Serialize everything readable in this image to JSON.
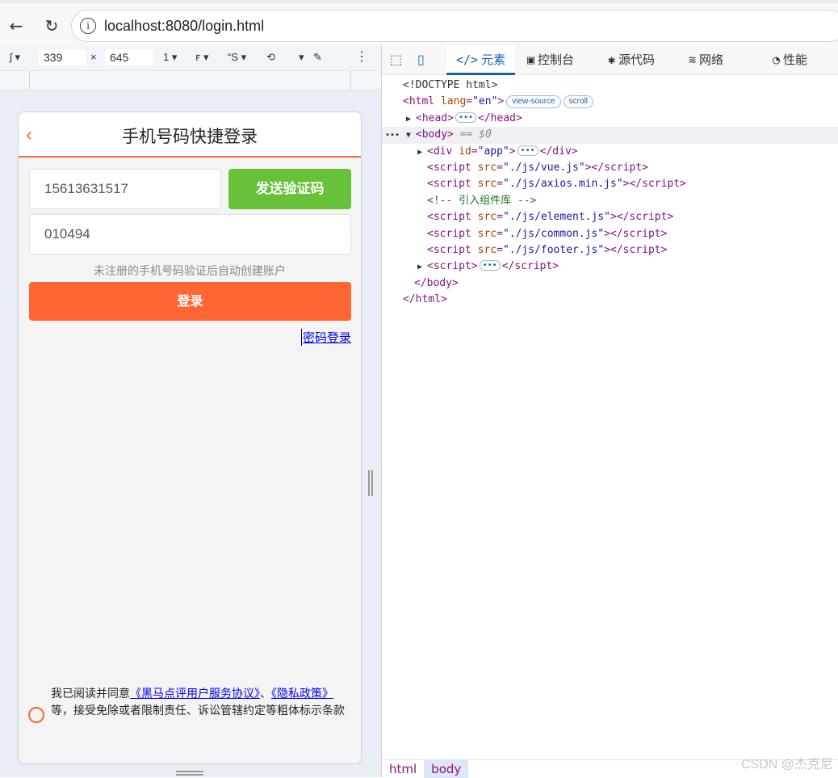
{
  "browser": {
    "url": "localhost:8080/login.html",
    "back_icon": "arrow-left-icon",
    "reload_icon": "reload-icon",
    "info_icon": "info-icon"
  },
  "device_toolbar": {
    "width": "339",
    "height": "645",
    "times": "×",
    "dpr": "1",
    "throttle": "“S",
    "more": "⋮"
  },
  "page": {
    "title": "手机号码快捷登录",
    "phone_value": "15613631517",
    "send_code_label": "发送验证码",
    "code_value": "010494",
    "hint": "未注册的手机号码验证后自动创建账户",
    "login_label": "登录",
    "password_login_link": "密码登录",
    "agreement_prefix": "我已阅读并同意",
    "agreement_link1": "《黑马点评用户服务协议》",
    "agreement_sep": "、",
    "agreement_link2": "《隐私政策》",
    "agreement_suffix": "等，接受免除或者限制责任、诉讼管辖约定等粗体标示条款"
  },
  "devtools": {
    "tabs": [
      {
        "label": "元素",
        "icon": "elements-icon",
        "active": true
      },
      {
        "label": "控制台",
        "icon": "console-icon",
        "active": false
      },
      {
        "label": "源代码",
        "icon": "sources-icon",
        "active": false
      },
      {
        "label": "网络",
        "icon": "network-icon",
        "active": false
      },
      {
        "label": "性能",
        "icon": "performance-icon",
        "active": false
      }
    ],
    "dom": {
      "doctype": "<!DOCTYPE html>",
      "html_lang_value": "\"en\"",
      "view_source_pill": "view-source",
      "scroll_pill": "scroll",
      "body_marker": "== $0",
      "div_id_value": "\"app\"",
      "script_vue": "\"./js/vue.js\"",
      "script_axios": "\"./js/axios.min.js\"",
      "comment": "<!-- 引入组件库 -->",
      "script_element": "\"./js/element.js\"",
      "script_common": "\"./js/common.js\"",
      "script_footer": "\"./js/footer.js\""
    },
    "breadcrumbs": [
      "html",
      "body"
    ]
  },
  "watermark": "CSDN @杰克尼"
}
